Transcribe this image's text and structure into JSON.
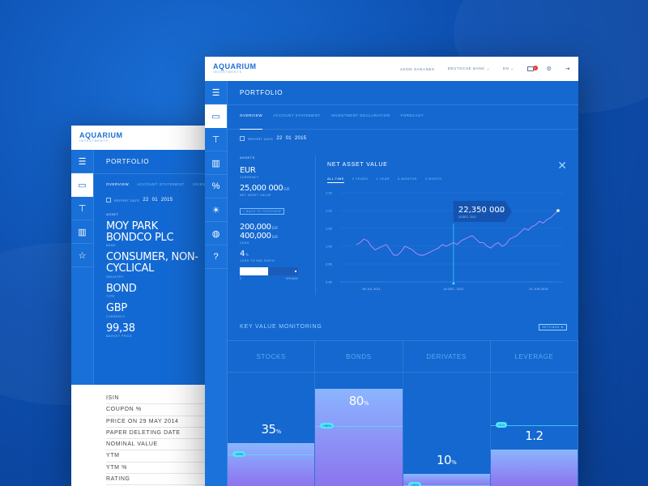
{
  "brand": {
    "name": "AQUARIUM",
    "tagline": "INVESTMENTS"
  },
  "colors": {
    "accent": "#4fe6ff",
    "primary": "#1468d0",
    "bar_top": "#8bb5ff",
    "bar_bottom": "#8c74ee"
  },
  "back_window": {
    "title": "PORTFOLIO",
    "tabs": [
      "OVERVIEW",
      "ACCOUNT STATEMENT",
      "INVESTI"
    ],
    "report_date_label": "REPORT DATE",
    "date": {
      "day": "22",
      "month": "01",
      "year": "2015"
    },
    "asset_label": "ASSET",
    "name": "MOY PARK BONDCO PLC",
    "name_sub": "NAME",
    "industry": "CONSUMER, NON-CYCLICAL",
    "industry_sub": "INDUSTRY",
    "type": "BOND",
    "type_sub": "TYPE",
    "currency": "GBP",
    "currency_sub": "CURRENCY",
    "market_price": "99,38",
    "market_price_sub": "MARKET PRICE",
    "list": [
      "ISIN",
      "COUPON %",
      "PRICE ON 29 MAY 2014",
      "PAPER DELETING DATE",
      "NOMINAL VALUE",
      "YTM",
      "YTM %",
      "RATING"
    ]
  },
  "front_window": {
    "nav": {
      "user": "AKON SANANES",
      "bank": "DEUTSCHE BANK",
      "lang": "EN",
      "mail_count": "3"
    },
    "title": "PORTFOLIO",
    "tabs": [
      "OVERVIEW",
      "ACCOUNT STATEMENT",
      "INVESTMENT DECLARATION",
      "FORECAST"
    ],
    "report_date_label": "REPORT DATE",
    "date": {
      "day": "22",
      "month": "01",
      "year": "2015"
    },
    "assets": {
      "label": "ASSETS",
      "currency": "EUR",
      "currency_sub": "CURRENCY",
      "nav_value": "25,000 000",
      "nav_unit": "EUR",
      "nav_sub": "NET ASSET VALUE",
      "back_button": "< BACK TO OVERVIEW",
      "value1": "200,000",
      "value1_unit": "EUR",
      "value2": "400,000",
      "value2_unit": "EUR",
      "cash_sub": "CASH",
      "ratio": "4",
      "ratio_unit": "%",
      "ratio_sub": "CASH TO NAV RATIO",
      "ratio_fill": 0.48,
      "axis_min": "0",
      "axis_max": "10% MAX"
    },
    "chart_panel": {
      "title": "NET ASSET VALUE",
      "ranges": [
        "ALL TIME",
        "3 YEARS",
        "1 YEAR",
        "6 MONTHS",
        "3 MONTH"
      ],
      "tooltip_value": "22,350 000",
      "tooltip_unit": "EUR",
      "tooltip_date": "18 DEC. 2012"
    },
    "kvm": {
      "title": "KEY VALUE MONITORING",
      "settings": "SETTINGS"
    }
  },
  "chart_data": [
    {
      "type": "line",
      "title": "NET ASSET VALUE",
      "y_ticks": [
        "1.15",
        "1.10",
        "1.05",
        "1.00",
        "0.95",
        "0.90"
      ],
      "x_ticks": [
        "08 JUL 2011",
        "18 DEC. 2012",
        "01 JUN 2015"
      ],
      "ylim": [
        0.9,
        1.15
      ],
      "series": [
        {
          "values": [
            1.005,
            1.01,
            1.02,
            1.015,
            1.0,
            0.99,
            0.995,
            1.0,
            1.005,
            0.99,
            0.975,
            0.975,
            0.985,
            1.0,
            0.995,
            0.99,
            0.98,
            0.975,
            0.975,
            0.98,
            0.985,
            0.99,
            0.995,
            1.005,
            1.0,
            1.005,
            1.01,
            1.005,
            1.015,
            1.02,
            1.025,
            1.03,
            1.02,
            1.01,
            1.01,
            1.0,
            0.995,
            1.005,
            1.01,
            1.0,
            1.005,
            1.02,
            1.025,
            1.03,
            1.04,
            1.05,
            1.045,
            1.055,
            1.06,
            1.07,
            1.065,
            1.075,
            1.08,
            1.09,
            1.1
          ]
        }
      ],
      "highlight": {
        "x": "18 DEC. 2012",
        "value": "22,350 000"
      }
    },
    {
      "type": "bar",
      "title": "KEY VALUE MONITORING",
      "categories": [
        "STOCKS",
        "BONDS",
        "DERIVATES",
        "LEVERAGE"
      ],
      "values": [
        35,
        80,
        10,
        1.2
      ],
      "display": [
        {
          "value": "35",
          "unit": "%",
          "badge": "+20%",
          "level": 0.35
        },
        {
          "value": "80",
          "unit": "%",
          "badge": "+50%",
          "level": 0.8
        },
        {
          "value": "10",
          "unit": "%",
          "badge": "+20%",
          "level": 0.1
        },
        {
          "value": "1.2",
          "unit": "",
          "badge": "+2.0",
          "level": 0.3
        }
      ]
    }
  ]
}
